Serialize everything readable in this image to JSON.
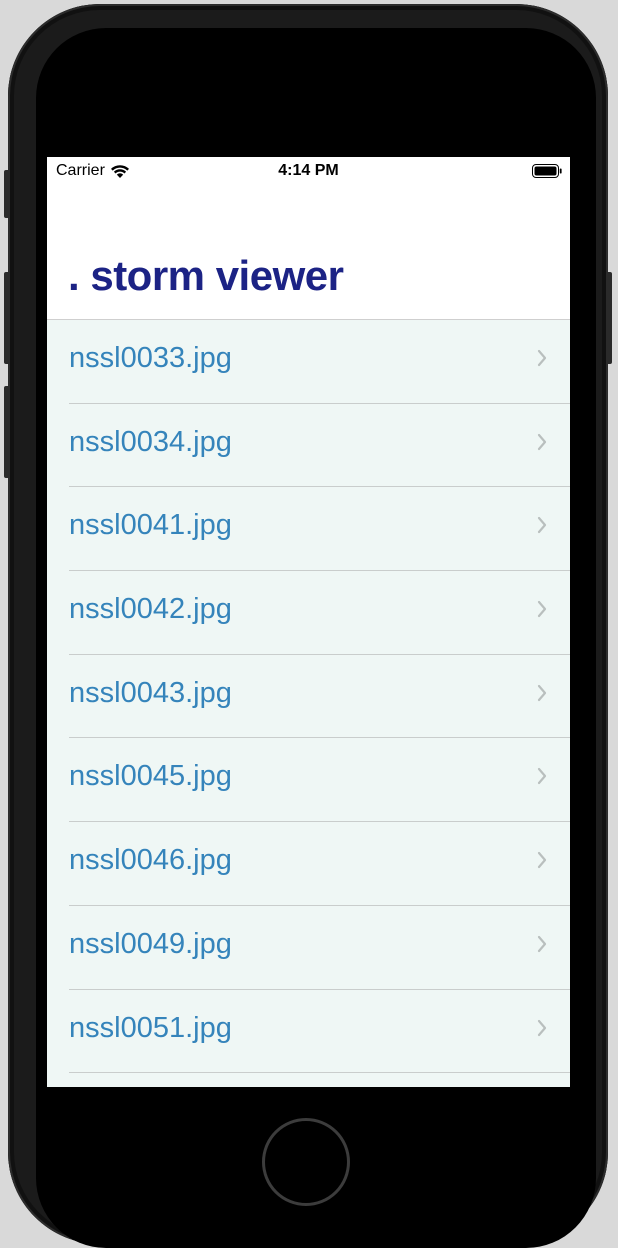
{
  "status_bar": {
    "carrier": "Carrier",
    "time": "4:14 PM",
    "wifi_icon": "wifi-icon",
    "battery_icon": "battery-icon"
  },
  "nav": {
    "title": ". storm viewer"
  },
  "list": {
    "items": [
      {
        "label": "nssl0033.jpg"
      },
      {
        "label": "nssl0034.jpg"
      },
      {
        "label": "nssl0041.jpg"
      },
      {
        "label": "nssl0042.jpg"
      },
      {
        "label": "nssl0043.jpg"
      },
      {
        "label": "nssl0045.jpg"
      },
      {
        "label": "nssl0046.jpg"
      },
      {
        "label": "nssl0049.jpg"
      },
      {
        "label": "nssl0051.jpg"
      }
    ],
    "chevron_icon": "chevron-right-icon"
  },
  "colors": {
    "title": "#1c2385",
    "row_text": "#3584bb",
    "list_background": "#eff7f5",
    "chevron": "#b9bfbe"
  }
}
